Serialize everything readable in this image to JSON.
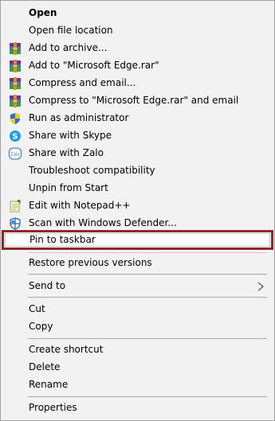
{
  "menu": {
    "items": [
      {
        "label": "Open"
      },
      {
        "label": "Open file location"
      },
      {
        "label": "Add to archive...",
        "icon": "winrar-icon"
      },
      {
        "label": "Add to \"Microsoft Edge.rar\"",
        "icon": "winrar-icon"
      },
      {
        "label": "Compress and email...",
        "icon": "winrar-icon"
      },
      {
        "label": "Compress to \"Microsoft Edge.rar\" and email",
        "icon": "winrar-icon"
      },
      {
        "label": "Run as administrator",
        "icon": "shield-icon"
      },
      {
        "label": "Share with Skype",
        "icon": "skype-icon"
      },
      {
        "label": "Share with Zalo",
        "icon": "zalo-icon"
      },
      {
        "label": "Troubleshoot compatibility"
      },
      {
        "label": "Unpin from Start"
      },
      {
        "label": "Edit with Notepad++",
        "icon": "notepadpp-icon"
      },
      {
        "label": "Scan with Windows Defender...",
        "icon": "windows-defender-icon"
      },
      {
        "label": "Pin to taskbar"
      },
      {
        "label": "Restore previous versions"
      },
      {
        "label": "Send to",
        "submenu": true
      },
      {
        "label": "Cut"
      },
      {
        "label": "Copy"
      },
      {
        "label": "Create shortcut"
      },
      {
        "label": "Delete"
      },
      {
        "label": "Rename"
      },
      {
        "label": "Properties"
      }
    ],
    "zalo_icon_text": "Zalo",
    "highlight_color": "#8c2a2a"
  }
}
